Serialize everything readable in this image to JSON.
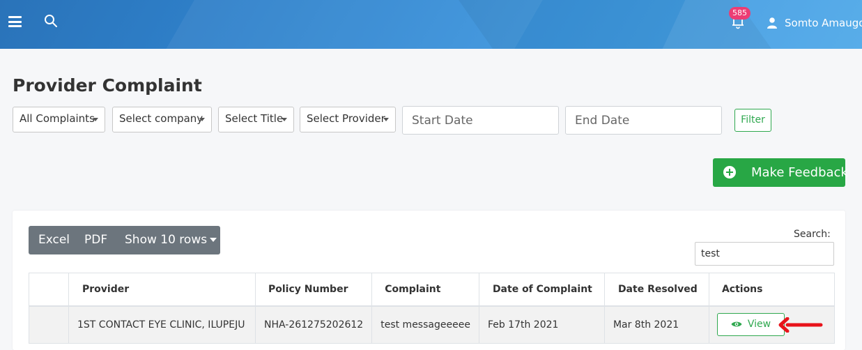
{
  "header": {
    "notification_count": "585",
    "user_name": "Somto Amaugo"
  },
  "page": {
    "title": "Provider Complaint"
  },
  "filters": {
    "complaint_type": "All Complaints",
    "company": "Select company",
    "title": "Select Title",
    "provider": "Select Provider",
    "start_date_placeholder": "Start Date",
    "end_date_placeholder": "End Date",
    "filter_label": "Filter"
  },
  "actions": {
    "make_feedback_label": "Make Feedback"
  },
  "toolbar": {
    "excel_label": "Excel",
    "pdf_label": "PDF",
    "show_rows_label": "Show 10 rows"
  },
  "search": {
    "label": "Search:",
    "value": "test"
  },
  "table": {
    "columns": [
      "Provider",
      "Policy Number",
      "Complaint",
      "Date of Complaint",
      "Date Resolved",
      "Actions"
    ],
    "rows": [
      {
        "provider": "1ST CONTACT EYE CLINIC, ILUPEJU",
        "policy_number": "NHA-261275202612",
        "complaint": "test messageeeee",
        "date_of_complaint": "Feb 17th 2021",
        "date_resolved": "Mar 8th 2021",
        "action_label": "View"
      }
    ]
  },
  "colors": {
    "header_blue": "#2f82cc",
    "accent_green": "#28a745",
    "badge_pink": "#ec3d74",
    "annotation_red": "#e8141b"
  }
}
